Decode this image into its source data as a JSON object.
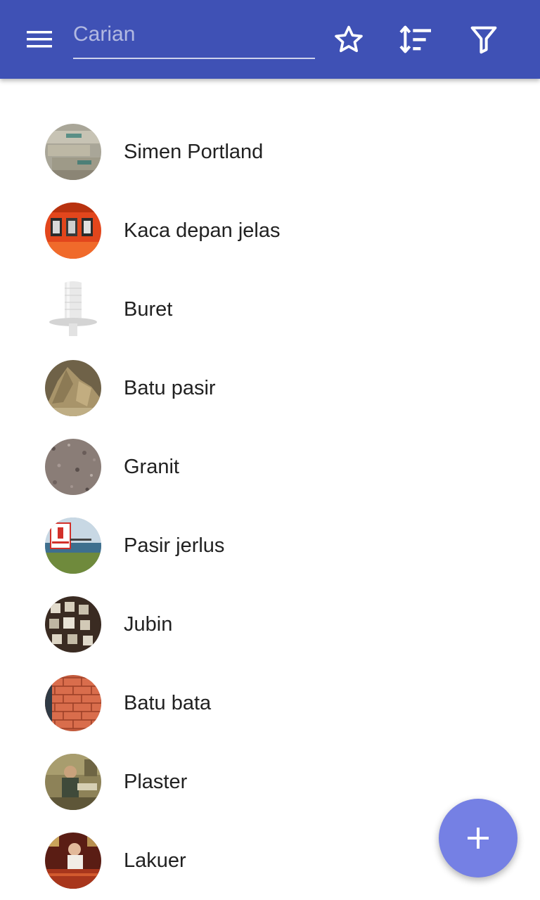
{
  "appbar": {
    "menu_icon": "hamburger-menu-icon",
    "search": {
      "placeholder": "Carian",
      "value": ""
    },
    "actions": [
      {
        "name": "favorite",
        "icon": "star-outline-icon"
      },
      {
        "name": "sort",
        "icon": "sort-icon"
      },
      {
        "name": "filter",
        "icon": "filter-icon"
      }
    ],
    "color": "#3f51b5"
  },
  "items": [
    {
      "label": "Simen Portland",
      "image": "cement-bags-thumbnail"
    },
    {
      "label": "Kaca depan jelas",
      "image": "orange-vehicle-windows-thumbnail"
    },
    {
      "label": "Buret",
      "image": "glass-burette-thumbnail"
    },
    {
      "label": "Batu pasir",
      "image": "sandstone-rock-thumbnail"
    },
    {
      "label": "Granit",
      "image": "granite-texture-thumbnail"
    },
    {
      "label": "Pasir jerlus",
      "image": "quicksand-warning-sign-thumbnail"
    },
    {
      "label": "Jubin",
      "image": "tiles-display-thumbnail"
    },
    {
      "label": "Batu bata",
      "image": "brick-stack-thumbnail"
    },
    {
      "label": "Plaster",
      "image": "plasterer-painting-thumbnail"
    },
    {
      "label": "Lakuer",
      "image": "lacquer-furniture-thumbnail"
    }
  ],
  "fab": {
    "icon": "plus-icon",
    "color": "#7580e4"
  }
}
